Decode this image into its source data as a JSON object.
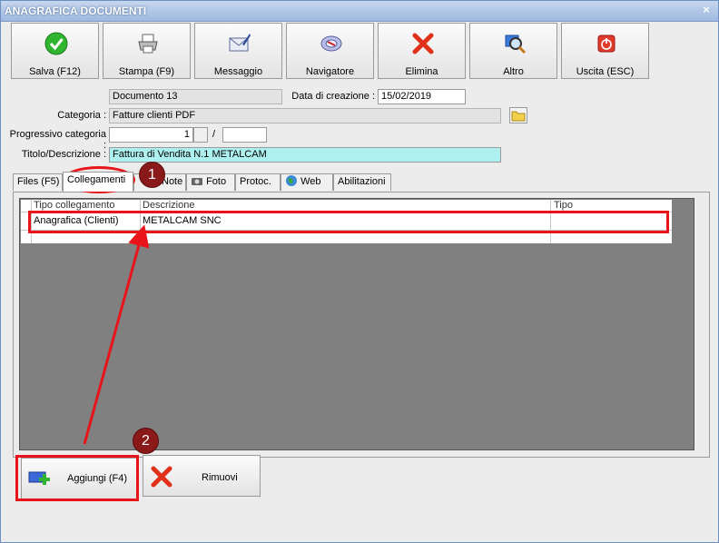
{
  "window": {
    "title": "ANAGRAFICA DOCUMENTI",
    "close_label": "×"
  },
  "toolbar": [
    {
      "label": "Salva (F12)",
      "icon": "check-icon"
    },
    {
      "label": "Stampa (F9)",
      "icon": "printer-icon"
    },
    {
      "label": "Messaggio",
      "icon": "envelope-icon"
    },
    {
      "label": "Navigatore",
      "icon": "compass-icon"
    },
    {
      "label": "Elimina",
      "icon": "delete-x-icon"
    },
    {
      "label": "Altro",
      "icon": "magnifier-icon"
    },
    {
      "label": "Uscita (ESC)",
      "icon": "power-icon"
    }
  ],
  "form": {
    "documento_value": "Documento 13",
    "data_creazione_label": "Data di creazione :",
    "data_creazione_value": "15/02/2019",
    "categoria_label": "Categoria :",
    "categoria_value": "Fatture clienti PDF",
    "progressivo_label": "Progressivo categoria :",
    "progressivo_value": "1",
    "progressivo_sep": "/",
    "progressivo_total": "",
    "titolo_label": "Titolo/Descrizione :",
    "titolo_value": "Fattura di Vendita N.1 METALCAM"
  },
  "tabs": [
    {
      "label": "Files (F5)"
    },
    {
      "label": "Collegamenti"
    },
    {
      "label": "Note"
    },
    {
      "label": "Foto"
    },
    {
      "label": "Protoc."
    },
    {
      "label": "Web"
    },
    {
      "label": "Abilitazioni"
    }
  ],
  "grid": {
    "columns": [
      "Tipo collegamento",
      "Descrizione",
      "Tipo"
    ],
    "rows": [
      [
        "Anagrafica (Clienti)",
        "METALCAM SNC",
        ""
      ]
    ]
  },
  "buttons": {
    "aggiungi_label": "Aggiungi (F4)",
    "rimuovi_label": "Rimuovi"
  },
  "annotations": {
    "badge1": "1",
    "badge2": "2"
  },
  "colors": {
    "annotation_red": "#e8141a",
    "badge_bg": "#8a1a1a",
    "title_cyan": "#aef0f0",
    "grid_gray": "#808080"
  }
}
